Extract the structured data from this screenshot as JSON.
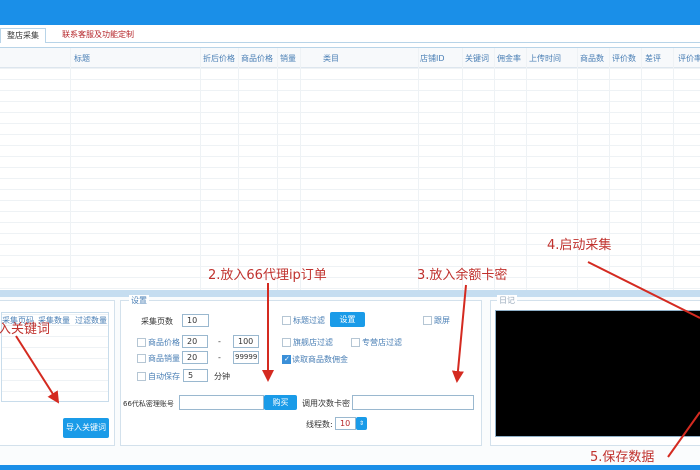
{
  "tabs": [
    {
      "label": "整店采集",
      "active": true
    },
    {
      "label": "联系客服及功能定制",
      "active": false
    }
  ],
  "table": {
    "columns": [
      "标题",
      "折后价格",
      "商品价格",
      "销量",
      "类目",
      "店铺ID",
      "关键词",
      "佣金率",
      "上传时间",
      "商品数",
      "评价数",
      "差评",
      "评价率"
    ]
  },
  "keywords_panel": {
    "columns": [
      "采集页码",
      "采集数量",
      "过滤数量"
    ],
    "import_button": "导入关键词"
  },
  "settings": {
    "legend": "设置",
    "pages_label": "采集页数",
    "pages_value": "10",
    "price_label": "商品价格",
    "price_min": "20",
    "price_max": "100",
    "price_checked": false,
    "sales_label": "商品销量",
    "sales_min": "20",
    "sales_max": "99999",
    "sales_checked": false,
    "range_dash": "-",
    "autosave_label": "自动保存",
    "autosave_value": "5",
    "autosave_unit": "分钟",
    "autosave_checked": false,
    "title_filter_label": "标题过滤",
    "title_filter_checked": false,
    "set_button": "设置",
    "follow_screen_label": "跟屏",
    "follow_screen_checked": false,
    "flagship_filter_label": "旗舰店过滤",
    "flagship_checked": false,
    "specialty_filter_label": "专营店过滤",
    "specialty_checked": false,
    "read_commission_label": "读取商品数佣金",
    "read_commission_checked": true,
    "proxy_label": "66代私密理账号",
    "proxy_value": "",
    "buy_button": "购买",
    "card_label": "调用次数卡密",
    "card_value": "",
    "threads_label": "线程数:",
    "threads_value": "10"
  },
  "log": {
    "legend": "日记"
  },
  "annotations": {
    "step1": "入关键词",
    "step2": "2.放入66代理ip订单",
    "step3": "3.放入余额卡密",
    "step4": "4.启动采集",
    "step5": "5.保存数据"
  },
  "colors": {
    "accent": "#1a8fe8",
    "annotation": "#c0322e",
    "link": "#b5262a"
  }
}
